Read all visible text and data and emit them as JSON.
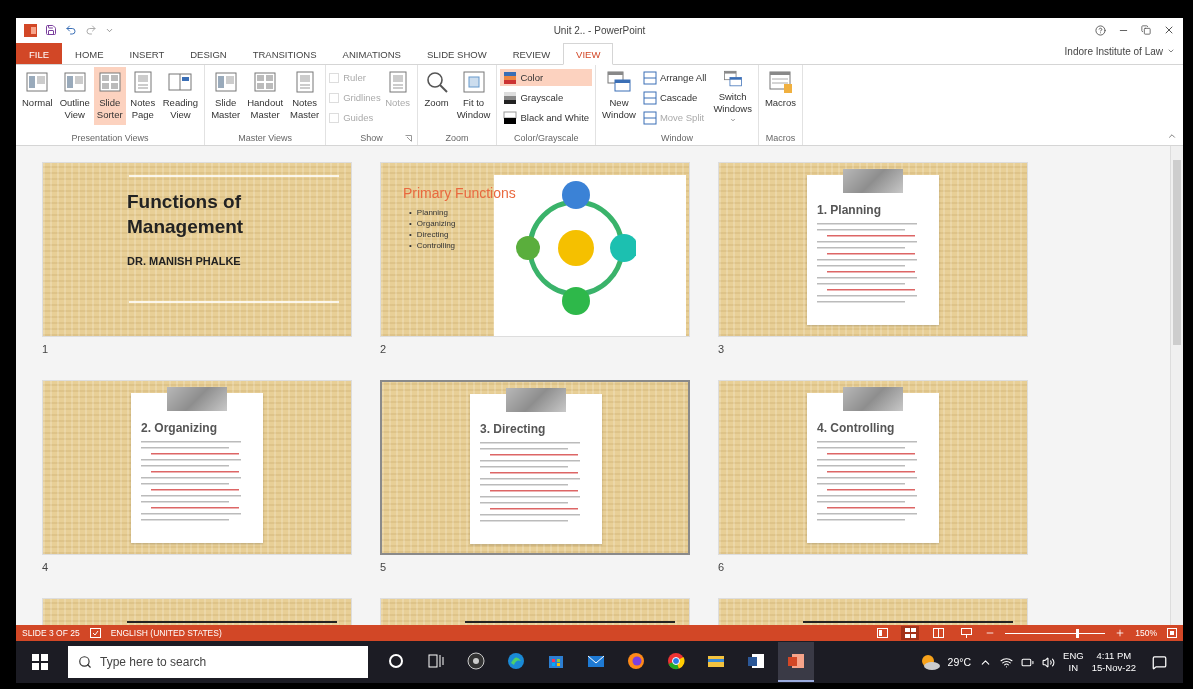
{
  "window": {
    "title": "Unit 2.. - PowerPoint",
    "account": "Indore Institute of Law"
  },
  "tabs": [
    {
      "label": "FILE",
      "kind": "file",
      "selected": false
    },
    {
      "label": "HOME",
      "kind": "tab",
      "selected": false
    },
    {
      "label": "INSERT",
      "kind": "tab",
      "selected": false
    },
    {
      "label": "DESIGN",
      "kind": "tab",
      "selected": false
    },
    {
      "label": "TRANSITIONS",
      "kind": "tab",
      "selected": false
    },
    {
      "label": "ANIMATIONS",
      "kind": "tab",
      "selected": false
    },
    {
      "label": "SLIDE SHOW",
      "kind": "tab",
      "selected": false
    },
    {
      "label": "REVIEW",
      "kind": "tab",
      "selected": false
    },
    {
      "label": "VIEW",
      "kind": "tab",
      "selected": true
    }
  ],
  "ribbon": [
    {
      "name": "Presentation Views",
      "items": [
        {
          "kind": "large",
          "label": "Normal",
          "selected": false,
          "disabled": false
        },
        {
          "kind": "large",
          "label": "Outline\nView",
          "selected": false,
          "disabled": false
        },
        {
          "kind": "large",
          "label": "Slide\nSorter",
          "selected": true,
          "disabled": false
        },
        {
          "kind": "large",
          "label": "Notes\nPage",
          "selected": false,
          "disabled": false
        },
        {
          "kind": "large",
          "label": "Reading\nView",
          "selected": false,
          "disabled": false
        }
      ]
    },
    {
      "name": "Master Views",
      "items": [
        {
          "kind": "large",
          "label": "Slide\nMaster",
          "selected": false,
          "disabled": false
        },
        {
          "kind": "large",
          "label": "Handout\nMaster",
          "selected": false,
          "disabled": false
        },
        {
          "kind": "large",
          "label": "Notes\nMaster",
          "selected": false,
          "disabled": false
        }
      ]
    },
    {
      "name": "Show",
      "launcher": true,
      "items": [
        {
          "kind": "checks",
          "checks": [
            {
              "label": "Ruler",
              "checked": false,
              "disabled": true
            },
            {
              "label": "Gridlines",
              "checked": false,
              "disabled": true
            },
            {
              "label": "Guides",
              "checked": false,
              "disabled": true
            }
          ]
        },
        {
          "kind": "large",
          "label": "Notes",
          "selected": false,
          "disabled": true
        }
      ]
    },
    {
      "name": "Zoom",
      "items": [
        {
          "kind": "large",
          "label": "Zoom",
          "selected": false,
          "disabled": false
        },
        {
          "kind": "large",
          "label": "Fit to\nWindow",
          "selected": false,
          "disabled": false
        }
      ]
    },
    {
      "name": "Color/Grayscale",
      "items": [
        {
          "kind": "smalls",
          "smalls": [
            {
              "label": "Color",
              "selected": true,
              "disabled": false
            },
            {
              "label": "Grayscale",
              "selected": false,
              "disabled": false
            },
            {
              "label": "Black and White",
              "selected": false,
              "disabled": false
            }
          ]
        }
      ]
    },
    {
      "name": "Window",
      "items": [
        {
          "kind": "large",
          "label": "New\nWindow",
          "selected": false,
          "disabled": false
        },
        {
          "kind": "smalls",
          "smalls": [
            {
              "label": "Arrange All",
              "selected": false,
              "disabled": false
            },
            {
              "label": "Cascade",
              "selected": false,
              "disabled": false
            },
            {
              "label": "Move Split",
              "selected": false,
              "disabled": true
            }
          ]
        },
        {
          "kind": "large",
          "label": "Switch\nWindows",
          "dropdown": true,
          "selected": false,
          "disabled": false
        }
      ]
    },
    {
      "name": "Macros",
      "items": [
        {
          "kind": "large",
          "label": "Macros",
          "selected": false,
          "disabled": false
        }
      ]
    }
  ],
  "slides": [
    {
      "kind": "title",
      "number": "1",
      "selected": false,
      "title": "Functions of\nManagement",
      "subtitle": "DR. MANISH PHALKE"
    },
    {
      "kind": "diagram",
      "number": "2",
      "selected": false,
      "title": "Primary Functions",
      "bullets": [
        {
          "marker": "•",
          "text": "Planning"
        },
        {
          "marker": "•",
          "text": "Organizing"
        },
        {
          "marker": "•",
          "text": "Directing"
        },
        {
          "marker": "•",
          "text": "Controlling"
        }
      ]
    },
    {
      "kind": "card",
      "number": "3",
      "selected": false,
      "title": "1. Planning"
    },
    {
      "kind": "card",
      "number": "4",
      "selected": false,
      "title": "2. Organizing"
    },
    {
      "kind": "card",
      "number": "5",
      "selected": true,
      "title": "3. Directing"
    },
    {
      "kind": "card",
      "number": "6",
      "selected": false,
      "title": "4. Controlling"
    },
    {
      "kind": "cut",
      "selected": false
    },
    {
      "kind": "cut",
      "selected": false
    },
    {
      "kind": "cut",
      "selected": false
    }
  ],
  "status_bar": {
    "slide": "SLIDE 3 OF 25",
    "language": "ENGLISH (UNITED STATES)",
    "views": [
      {
        "kind": "normal",
        "selected": false
      },
      {
        "kind": "sorter",
        "selected": true
      },
      {
        "kind": "reading",
        "selected": false
      },
      {
        "kind": "show",
        "selected": false
      }
    ],
    "zoom": {
      "level": 0.72,
      "reading": "150%"
    }
  },
  "taskbar": {
    "placeholder": "Type here to search",
    "apps": [
      {
        "kind": "cortana",
        "selected": false
      },
      {
        "kind": "taskview",
        "selected": false
      },
      {
        "kind": "obs",
        "selected": false
      },
      {
        "kind": "edge",
        "selected": false
      },
      {
        "kind": "store",
        "selected": false
      },
      {
        "kind": "mail",
        "selected": false
      },
      {
        "kind": "firefox",
        "selected": false
      },
      {
        "kind": "chrome",
        "selected": false
      },
      {
        "kind": "files",
        "selected": false
      },
      {
        "kind": "word",
        "selected": false
      },
      {
        "kind": "powerpoint",
        "selected": true
      }
    ],
    "temperature": "29°C",
    "language": "ENG",
    "region": "IN",
    "time": "4:11 PM",
    "date": "15-Nov-22"
  }
}
